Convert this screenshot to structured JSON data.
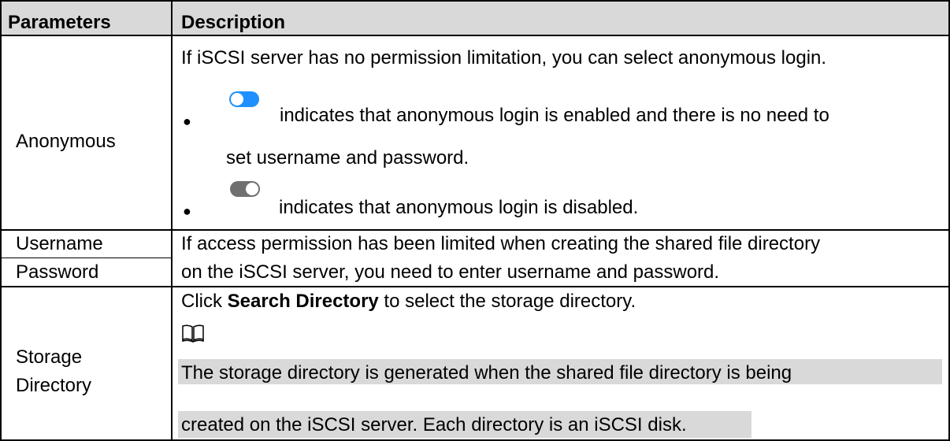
{
  "table": {
    "header": {
      "col1": "Parameters",
      "col2": "Description"
    },
    "anonymous": {
      "name": "Anonymous",
      "intro": "If iSCSI server has no permission limitation, you can select anonymous login.",
      "bullet_glyph": "●",
      "enabled_line1": "indicates that anonymous login is enabled and there is no need to",
      "enabled_line2": "set username and password.",
      "disabled_text": "indicates that anonymous login is disabled.",
      "enabled_toggle": {
        "state": "on",
        "color": "#1e90ff",
        "icon": "toggle-on-icon"
      },
      "disabled_toggle": {
        "state": "off",
        "color": "#707070",
        "icon": "toggle-off-icon"
      }
    },
    "credentials": {
      "username": "Username",
      "password": "Password",
      "desc_line1": "If access permission has been limited when creating the shared file directory",
      "desc_line2": "on the iSCSI server, you need to enter username and password."
    },
    "storage": {
      "name_line1": "Storage",
      "name_line2": "Directory",
      "click": "Click ",
      "search_directory": "Search Directory",
      "after": " to select the storage directory.",
      "note_icon": "book-icon",
      "note_line1": "The storage directory is generated when the shared file directory is being",
      "note_line2": "created on the iSCSI server. Each directory is an iSCSI disk."
    }
  }
}
